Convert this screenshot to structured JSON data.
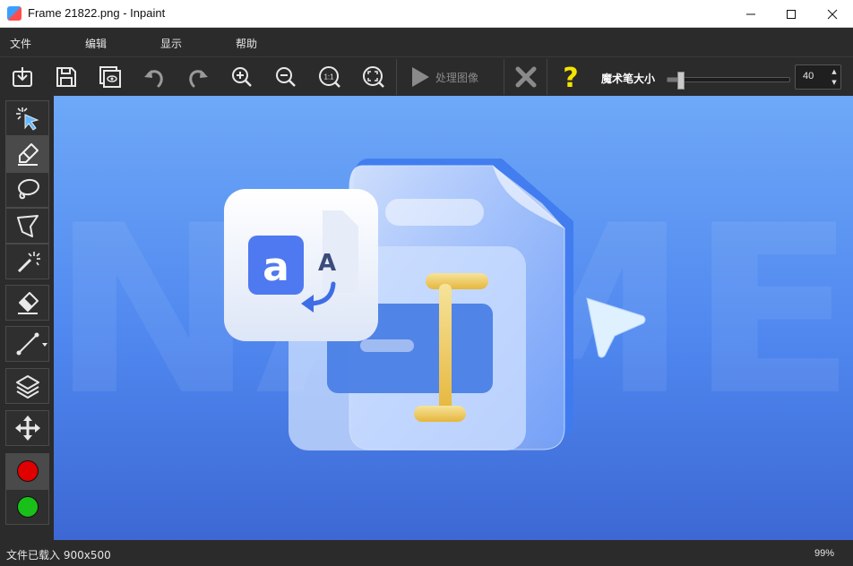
{
  "window": {
    "title": "Frame 21822.png - Inpaint",
    "controls": [
      "minimize",
      "maximize",
      "close"
    ]
  },
  "menu": [
    "文件",
    "编辑",
    "显示",
    "帮助"
  ],
  "toolbar": {
    "buttons": [
      "open-icon",
      "save-icon",
      "batch-icon",
      "undo-icon",
      "redo-icon",
      "zoom-in-icon",
      "zoom-out-icon",
      "actual-size-icon",
      "fit-icon"
    ],
    "process_label": "处理图像",
    "cancel": "cancel-icon",
    "help": "help-icon",
    "brush_size_label": "魔术笔大小",
    "brush_size_value": "40",
    "brush_size_fraction": 0.1
  },
  "tools": [
    "smart-select-icon",
    "marker-icon",
    "lasso-icon",
    "polygon-lasso-icon",
    "magic-wand-icon",
    "eraser-icon",
    "guide-line-icon",
    "layers-icon",
    "move-icon"
  ],
  "colors": {
    "mask": "#e00000",
    "donor": "#19c019",
    "canvas_top": "#6ea8f7",
    "canvas_bottom": "#3d68d4"
  },
  "canvas": {
    "background_text": "NAME"
  },
  "status": {
    "left": "文件已载入 900x500",
    "zoom": "99%"
  }
}
